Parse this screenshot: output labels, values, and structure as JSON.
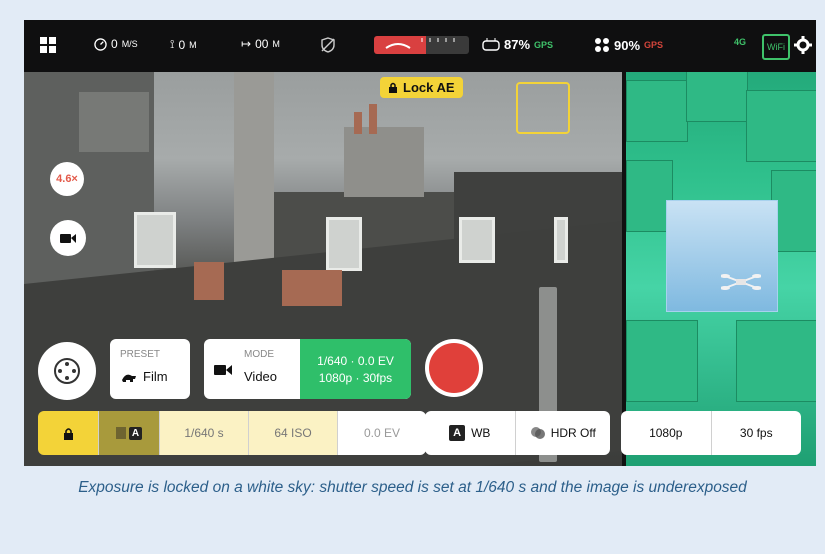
{
  "top_bar": {
    "menu_icon": "grid-icon",
    "speed": "0",
    "speed_unit": "M/S",
    "altitude": "0",
    "altitude_unit": "M",
    "distance": "00",
    "distance_unit": "M",
    "controller_battery": "87%",
    "controller_gps": "GPS",
    "drone_battery": "90%",
    "drone_gps": "GPS",
    "network": "4G",
    "wifi": "WiFi",
    "colors": {
      "ok": "#3fc26a",
      "bad": "#d3453b"
    }
  },
  "overlay": {
    "lock_ae_label": "Lock AE",
    "zoom_label": "4.6×"
  },
  "controls": {
    "preset_label": "PRESET",
    "preset_value": "Film",
    "mode_label": "MODE",
    "mode_value": "Video",
    "exposure_summary": "1/640 · 0.0 EV",
    "video_summary": "1080p · 30fps"
  },
  "bottom_bar": {
    "auto_badge": "A",
    "shutter": "1/640 s",
    "iso": "64 ISO",
    "ev": "0.0 EV",
    "wb_badge": "A",
    "wb_label": "WB",
    "hdr_label": "HDR Off",
    "resolution": "1080p",
    "framerate": "30 fps",
    "colors": {
      "lock": "#f3d338",
      "light_yellow": "#fbf2c4"
    }
  },
  "caption": "Exposure is locked on a white sky: shutter speed is set at 1/640 s and the image is underexposed"
}
